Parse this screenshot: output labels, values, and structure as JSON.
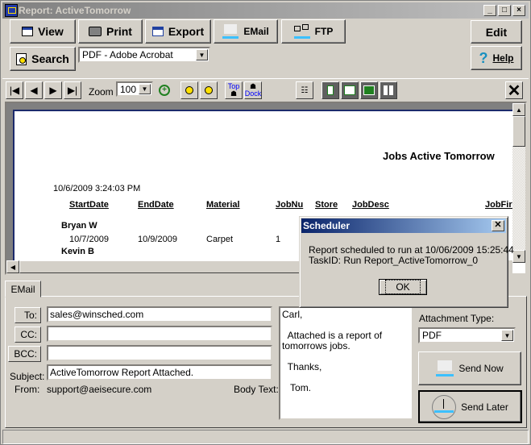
{
  "window": {
    "title": "Report: ActiveTomorrow",
    "controls": {
      "minimize": "_",
      "maximize": "□",
      "close": "×"
    }
  },
  "toolbar": {
    "view": "View",
    "print": "Print",
    "export": "Export",
    "email": "EMail",
    "ftp": "FTP",
    "edit": "Edit",
    "search": "Search",
    "help": "Help",
    "export_format": "PDF - Adobe Acrobat"
  },
  "nav": {
    "zoom_label": "Zoom",
    "zoom_value": "100",
    "top_label": "Top",
    "dock_label": "Dock"
  },
  "report": {
    "title": "Jobs Active Tomorrow",
    "timestamp": "10/6/2009 3:24:03 PM",
    "columns": [
      "StartDate",
      "EndDate",
      "Material",
      "JobNu",
      "Store",
      "JobDesc",
      "JobFirs"
    ],
    "groups": [
      {
        "name": "Bryan W",
        "rows": [
          {
            "start": "10/7/2009",
            "end": "10/9/2009",
            "material": "Carpet",
            "jobnum": "1"
          }
        ]
      },
      {
        "name": "Kevin B",
        "rows": []
      }
    ]
  },
  "email": {
    "tab_label": "EMail",
    "to_label": "To:",
    "cc_label": "CC:",
    "bcc_label": "BCC:",
    "subject_label": "Subject:",
    "from_label": "From:",
    "body_label": "Body Text:",
    "to_value": "sales@winsched.com",
    "cc_value": "",
    "bcc_value": "",
    "subject_value": "ActiveTomorrow Report Attached.",
    "from_value": "support@aeisecure.com",
    "body_value": "Carl,\n\n  Attached is a report of tomorrows jobs.\n\n  Thanks,\n\n   Tom.",
    "attachment_label": "Attachment Type:",
    "attachment_value": "PDF",
    "send_now": "Send Now",
    "send_later": "Send Later"
  },
  "dialog": {
    "title": "Scheduler",
    "line1": "Report scheduled to run at 10/06/2009 15:25:44",
    "line2": "TaskID: Run Report_ActiveTomorrow_0",
    "ok": "OK"
  }
}
